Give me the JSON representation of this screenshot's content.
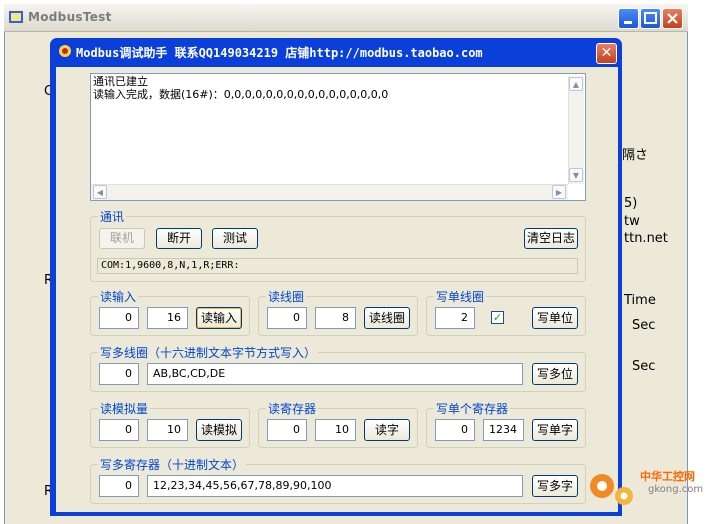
{
  "bg_window": {
    "title": "ModbusTest",
    "partial_texts": {
      "t1": "隔さ",
      "t2": "5)",
      "t3": "tw",
      "t4": "ttn.net",
      "t5": "Time",
      "t6": "Sec",
      "t7": "Sec",
      "t8": "C",
      "t9": "R",
      "t10": "R"
    }
  },
  "dialog": {
    "title": "Modbus调试助手  联系QQ149034219  店铺http://modbus.taobao.com",
    "close_glyph": "✕"
  },
  "log": {
    "line1": "通讯已建立",
    "line2": "读输入完成，数据(16#)：0,0,0,0,0,0,0,0,0,0,0,0,0,0,0,0"
  },
  "comm": {
    "label": "通讯",
    "connect": "联机",
    "disconnect": "断开",
    "test": "测试",
    "clear_log": "清空日志",
    "status": "COM:1,9600,8,N,1,R;ERR:"
  },
  "read_input": {
    "label": "读输入",
    "addr": "0",
    "count": "16",
    "button": "读输入"
  },
  "read_coil": {
    "label": "读线圈",
    "addr": "0",
    "count": "8",
    "button": "读线圈"
  },
  "write_coil": {
    "label": "写单线圈",
    "addr": "2",
    "check": "✓",
    "button": "写单位"
  },
  "write_multi_coil": {
    "label": "写多线圈（十六进制文本字节方式写入）",
    "addr": "0",
    "value": "AB,BC,CD,DE",
    "button": "写多位"
  },
  "read_analog": {
    "label": "读模拟量",
    "addr": "0",
    "count": "10",
    "button": "读模拟"
  },
  "read_register": {
    "label": "读寄存器",
    "addr": "0",
    "count": "10",
    "button": "读字"
  },
  "write_register": {
    "label": "写单个寄存器",
    "addr": "0",
    "value": "1234",
    "button": "写单字"
  },
  "write_multi_register": {
    "label": "写多寄存器（十进制文本）",
    "addr": "0",
    "value": "12,23,34,45,56,67,78,89,90,100",
    "button": "写多字"
  },
  "watermark": {
    "text": "中华工控网",
    "url": "gkong.com"
  }
}
